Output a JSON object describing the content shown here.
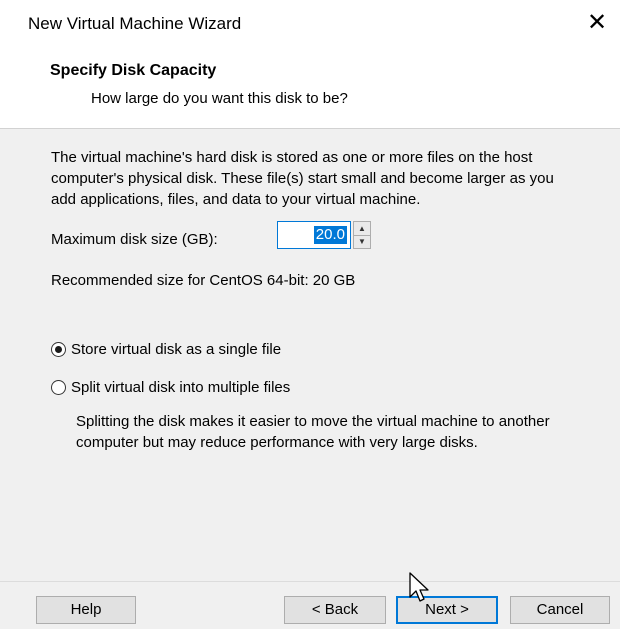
{
  "window": {
    "title": "New Virtual Machine Wizard",
    "close_glyph": "✕"
  },
  "header": {
    "title": "Specify Disk Capacity",
    "subtitle": "How large do you want this disk to be?"
  },
  "description": {
    "line1": "The virtual machine's hard disk is stored as one or more files on the host",
    "line2": "computer's physical disk. These file(s) start small and become larger as you",
    "line3": "add applications, files, and data to your virtual machine."
  },
  "disk_size": {
    "label": "Maximum disk size (GB):",
    "value": "20.0",
    "up_glyph": "▲",
    "down_glyph": "▼"
  },
  "recommended": "Recommended size for CentOS 64-bit: 20 GB",
  "storage_options": {
    "single": {
      "label": "Store virtual disk as a single file",
      "selected": true
    },
    "split": {
      "label": "Split virtual disk into multiple files",
      "selected": false
    },
    "split_note_line1": "Splitting the disk makes it easier to move the virtual machine to another",
    "split_note_line2": "computer but may reduce performance with very large disks."
  },
  "buttons": {
    "help": "Help",
    "back": "< Back",
    "next": "Next >",
    "cancel": "Cancel"
  },
  "colors": {
    "accent": "#0078d7",
    "panel_bg": "#f0f0f0",
    "header_bg": "#ffffff"
  }
}
